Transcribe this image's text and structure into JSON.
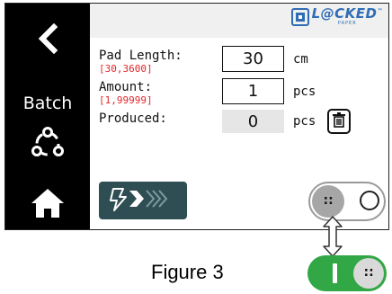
{
  "sidebar": {
    "back_icon": "chevron-left-icon",
    "batch_label": "Batch",
    "cycle_icon": "cycle-icon",
    "home_icon": "home-icon",
    "background": "#000000"
  },
  "logo": {
    "text": "L@CKED",
    "subtext": "PAPER",
    "trademark": "™",
    "color": "#2f6db5"
  },
  "fields": {
    "pad_length": {
      "label": "Pad Length:",
      "range": "[30,3600]",
      "value": "30",
      "unit": "cm"
    },
    "amount": {
      "label": "Amount:",
      "range": "[1,99999]",
      "value": "1",
      "unit": "pcs"
    },
    "produced": {
      "label": "Produced:",
      "value": "0",
      "unit": "pcs",
      "reset_icon": "trash-icon"
    }
  },
  "controls": {
    "start_icon": "lightning-start-icon",
    "start_color": "#2f4e54",
    "toggle_state": "off",
    "toggle_on_state": "on",
    "toggle_on_color": "#32a745"
  },
  "caption": "Figure 3"
}
